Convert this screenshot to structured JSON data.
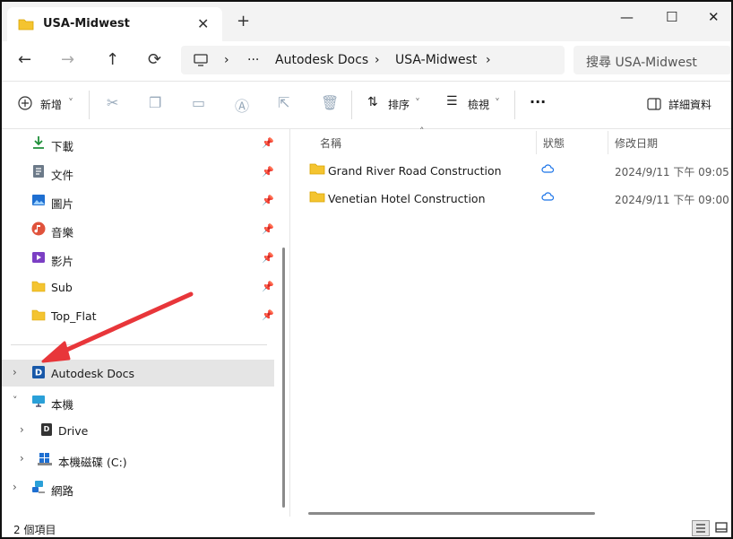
{
  "window": {
    "tab_title": "USA-Midwest",
    "tab_close": "✕",
    "new_tab": "+",
    "minimize": "—",
    "maximize": "☐",
    "close": "✕"
  },
  "nav": {
    "back": "←",
    "forward": "→",
    "up": "↑",
    "refresh": "⟳",
    "breadcrumb": [
      "Autodesk Docs",
      "USA-Midwest"
    ],
    "ellipsis": "···",
    "chevron": "›",
    "search_placeholder": "搜尋 USA-Midwest"
  },
  "toolbar": {
    "new_label": "新增",
    "sort_label": "排序",
    "view_label": "檢視",
    "more_label": "···",
    "details_label": "詳細資料"
  },
  "sidebar": {
    "quick_access": [
      {
        "label": "下載",
        "icon": "download-icon"
      },
      {
        "label": "文件",
        "icon": "document-icon"
      },
      {
        "label": "圖片",
        "icon": "pictures-icon"
      },
      {
        "label": "音樂",
        "icon": "music-icon"
      },
      {
        "label": "影片",
        "icon": "videos-icon"
      },
      {
        "label": "Sub",
        "icon": "folder-icon"
      },
      {
        "label": "Top_Flat",
        "icon": "folder-icon"
      }
    ],
    "tree": [
      {
        "label": "Autodesk Docs",
        "icon": "autodesk-docs-icon",
        "expanded": false,
        "selected": true
      },
      {
        "label": "本機",
        "icon": "this-pc-icon",
        "expanded": true
      },
      {
        "label": "Drive",
        "icon": "drive-icon",
        "expanded": false
      },
      {
        "label": "本機磁碟 (C:)",
        "icon": "local-disk-icon",
        "expanded": false
      },
      {
        "label": "網路",
        "icon": "network-icon",
        "expanded": false
      }
    ]
  },
  "list": {
    "columns": {
      "name": "名稱",
      "status": "狀態",
      "modified": "修改日期"
    },
    "rows": [
      {
        "name": "Grand River Road Construction",
        "status": "cloud",
        "modified": "2024/9/11 下午 09:05"
      },
      {
        "name": "Venetian Hotel Construction",
        "status": "cloud",
        "modified": "2024/9/11 下午 09:00"
      }
    ]
  },
  "status": {
    "item_count": "2 個項目"
  },
  "colors": {
    "folder": "#f4c430",
    "accent": "#0067c0",
    "annotation_arrow": "#e8363a",
    "cloud": "#1a73e8"
  }
}
